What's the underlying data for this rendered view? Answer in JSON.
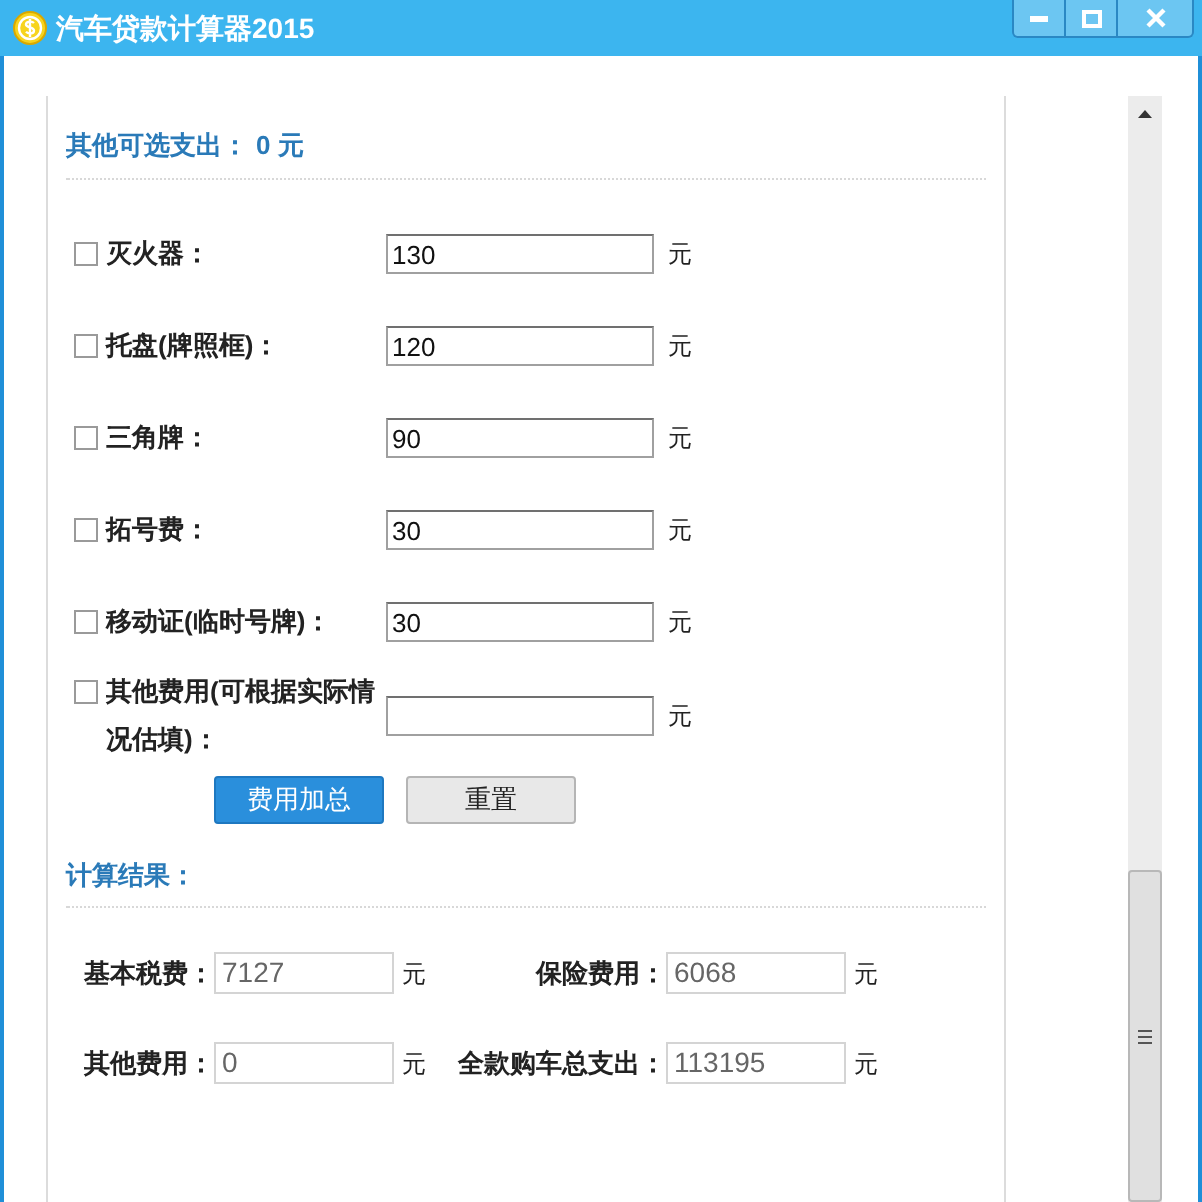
{
  "window": {
    "title": "汽车贷款计算器2015"
  },
  "optional_expense": {
    "label": "其他可选支出：",
    "value": "0",
    "unit": "元"
  },
  "items": [
    {
      "label": "灭火器：",
      "value": "130",
      "unit": "元",
      "checked": false
    },
    {
      "label": "托盘(牌照框)：",
      "value": "120",
      "unit": "元",
      "checked": false
    },
    {
      "label": "三角牌：",
      "value": "90",
      "unit": "元",
      "checked": false
    },
    {
      "label": "拓号费：",
      "value": "30",
      "unit": "元",
      "checked": false
    },
    {
      "label": "移动证(临时号牌)：",
      "value": "30",
      "unit": "元",
      "checked": false
    },
    {
      "label": "其他费用(可根据实际情况估填)：",
      "value": "",
      "unit": "元",
      "checked": false
    }
  ],
  "buttons": [
    {
      "label": "费用加总",
      "kind": "primary"
    },
    {
      "label": "重置",
      "kind": "default"
    }
  ],
  "results": {
    "heading": "计算结果：",
    "fields": [
      {
        "label": "基本税费：",
        "value": "7127",
        "unit": "元"
      },
      {
        "label": "保险费用：",
        "value": "6068",
        "unit": "元"
      },
      {
        "label": "其他费用：",
        "value": "0",
        "unit": "元"
      },
      {
        "label": "全款购车总支出：",
        "value": "113195",
        "unit": "元"
      }
    ]
  }
}
